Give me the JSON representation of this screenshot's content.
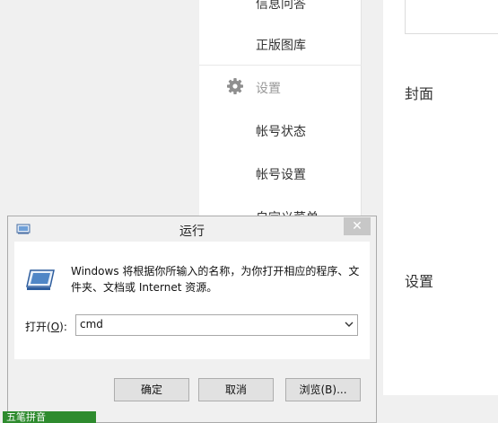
{
  "sidebar": {
    "items_top": [
      "信息问答",
      "正版图库"
    ],
    "section_title": "设置",
    "items_settings": [
      "帐号状态",
      "帐号设置",
      "自定义菜单"
    ]
  },
  "main": {
    "label_cover": "封面",
    "label_settings": "设置"
  },
  "dialog": {
    "title": "运行",
    "close_label": "✕",
    "description": "Windows 将根据你所输入的名称，为你打开相应的程序、文件夹、文档或 Internet 资源。",
    "open_label_prefix": "打开(",
    "open_label_hotkey": "O",
    "open_label_suffix": "):",
    "combo_value": "cmd",
    "buttons": {
      "ok": "确定",
      "cancel": "取消",
      "browse": "浏览(B)..."
    }
  },
  "ime": {
    "label": "五笔拼音"
  },
  "colors": {
    "ime_green": "#2e8b2e",
    "close_gray": "#c7c7c7",
    "dialog_bg": "#f0f0f0"
  }
}
